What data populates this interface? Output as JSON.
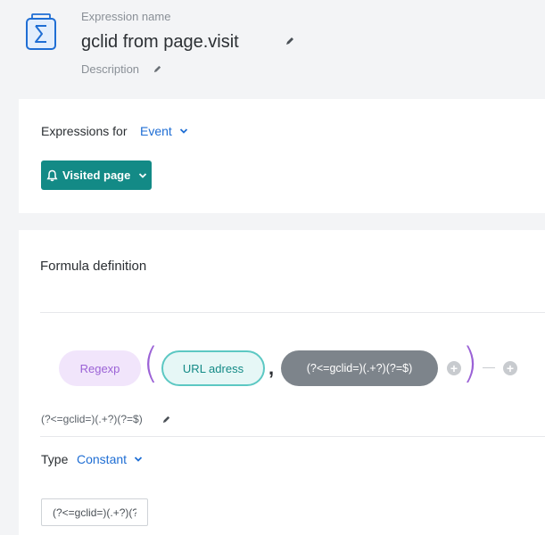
{
  "header": {
    "name_label": "Expression name",
    "title": "gclid from page.visit",
    "description_label": "Description",
    "icon": "sigma-icon"
  },
  "expressions_card": {
    "label": "Expressions for",
    "dropdown_value": "Event",
    "event_button": "Visited page",
    "event_icon": "bell-icon"
  },
  "formula_card": {
    "title": "Formula definition",
    "function_pill": "Regexp",
    "argument_pill": "URL adress",
    "constant_pill": "(?<=gclid=)(.+?)(?=$)",
    "regex_text": "(?<=gclid=)(.+?)(?=$)",
    "type_label": "Type",
    "type_value": "Constant",
    "value_input": "(?<=gclid=)(.+?)(?=$)"
  },
  "colors": {
    "accent_blue": "#1f6ed4",
    "teal": "#138a86",
    "purple": "#9b62d6"
  }
}
